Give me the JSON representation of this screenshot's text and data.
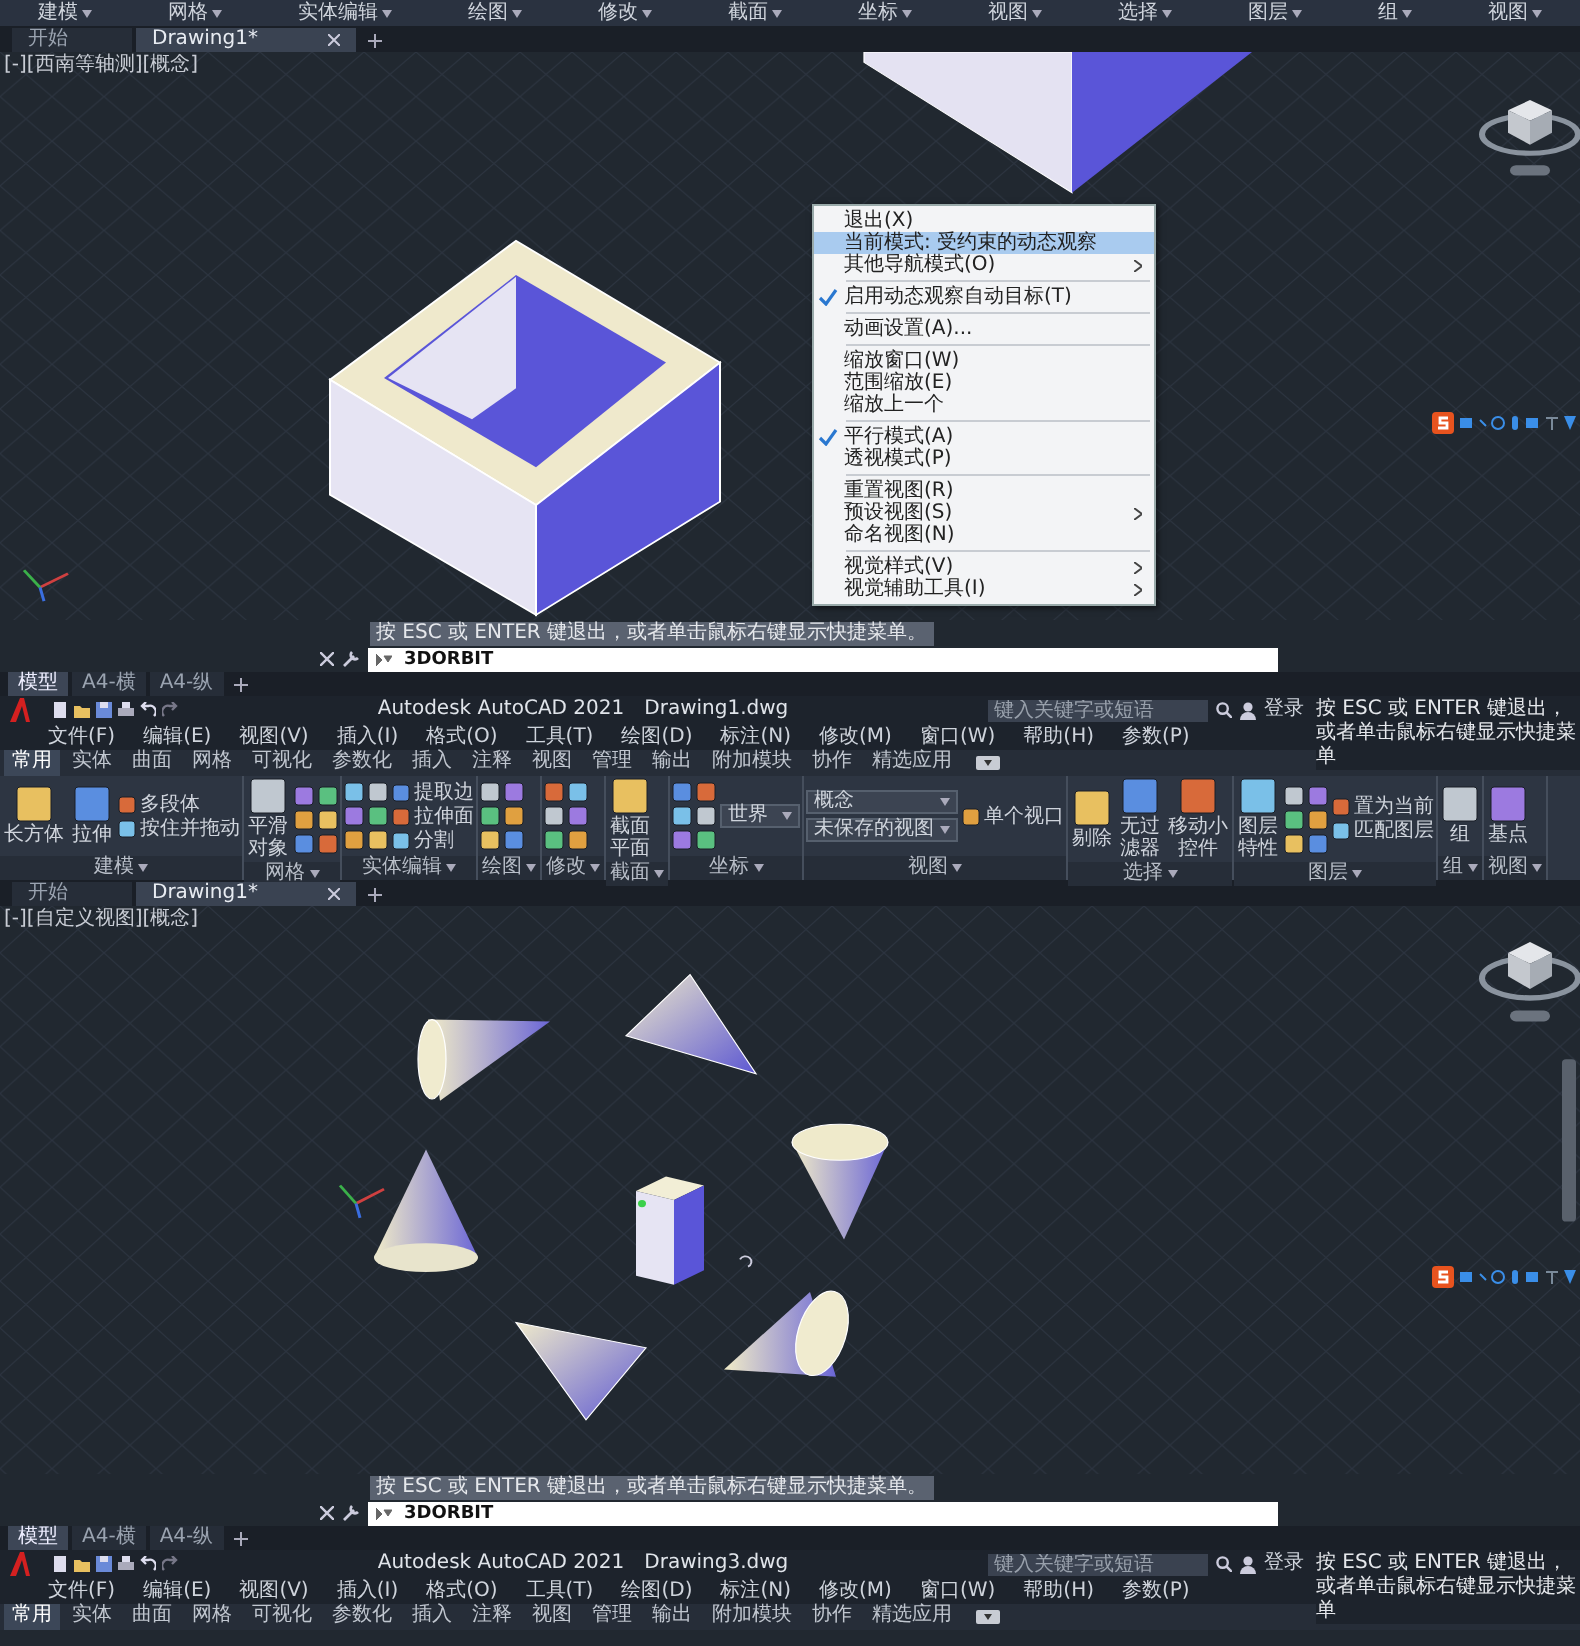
{
  "top_capture": {
    "ribbon_panel_labels": [
      "建模",
      "网格",
      "实体编辑",
      "绘图",
      "修改",
      "截面",
      "坐标",
      "视图",
      "选择",
      "图层",
      "组",
      "视图"
    ],
    "doc_tabs": [
      {
        "label": "开始",
        "selected": false
      },
      {
        "label": "Drawing1*",
        "selected": true
      }
    ],
    "viewport_label": "[-][西南等轴测][概念]",
    "context_menu": {
      "groups": [
        [
          {
            "label": "退出(X)",
            "checked": false,
            "selected": false,
            "submenu": false
          },
          {
            "label": "当前模式: 受约束的动态观察",
            "checked": false,
            "selected": true,
            "submenu": false
          },
          {
            "label": "其他导航模式(O)",
            "checked": false,
            "selected": false,
            "submenu": true
          }
        ],
        [
          {
            "label": "启用动态观察自动目标(T)",
            "checked": true,
            "selected": false,
            "submenu": false
          }
        ],
        [
          {
            "label": "动画设置(A)...",
            "checked": false,
            "selected": false,
            "submenu": false
          }
        ],
        [
          {
            "label": "缩放窗口(W)",
            "checked": false,
            "selected": false,
            "submenu": false
          },
          {
            "label": "范围缩放(E)",
            "checked": false,
            "selected": false,
            "submenu": false
          },
          {
            "label": "缩放上一个",
            "checked": false,
            "selected": false,
            "submenu": false
          }
        ],
        [
          {
            "label": "平行模式(A)",
            "checked": true,
            "selected": false,
            "submenu": false
          },
          {
            "label": "透视模式(P)",
            "checked": false,
            "selected": false,
            "submenu": false
          }
        ],
        [
          {
            "label": "重置视图(R)",
            "checked": false,
            "selected": false,
            "submenu": false
          },
          {
            "label": "预设视图(S)",
            "checked": false,
            "selected": false,
            "submenu": true
          },
          {
            "label": "命名视图(N)",
            "checked": false,
            "selected": false,
            "submenu": false
          }
        ],
        [
          {
            "label": "视觉样式(V)",
            "checked": false,
            "selected": false,
            "submenu": true
          },
          {
            "label": "视觉辅助工具(I)",
            "checked": false,
            "selected": false,
            "submenu": true
          }
        ]
      ]
    },
    "command_prompt": "按 ESC 或 ENTER 键退出，或者单击鼠标右键显示快捷菜单。",
    "command_input": "3DORBIT"
  },
  "middle_window": {
    "layout_tabs": [
      {
        "label": "模型",
        "selected": true
      },
      {
        "label": "A4-横",
        "selected": false
      },
      {
        "label": "A4-纵",
        "selected": false
      }
    ],
    "app_title": "Autodesk AutoCAD 2021",
    "file_name": "Drawing1.dwg",
    "search_placeholder": "键入关键字或短语",
    "sign_in": "登录",
    "status_hint": "按 ESC 或 ENTER 键退出，或者单击鼠标右键显示快捷菜单",
    "menu_bar": [
      "文件(F)",
      "编辑(E)",
      "视图(V)",
      "插入(I)",
      "格式(O)",
      "工具(T)",
      "绘图(D)",
      "标注(N)",
      "修改(M)",
      "窗口(W)",
      "帮助(H)",
      "参数(P)"
    ],
    "ribbon_tabs": [
      {
        "label": "常用",
        "selected": true
      },
      {
        "label": "实体",
        "selected": false
      },
      {
        "label": "曲面",
        "selected": false
      },
      {
        "label": "网格",
        "selected": false
      },
      {
        "label": "可视化",
        "selected": false
      },
      {
        "label": "参数化",
        "selected": false
      },
      {
        "label": "插入",
        "selected": false
      },
      {
        "label": "注释",
        "selected": false
      },
      {
        "label": "视图",
        "selected": false
      },
      {
        "label": "管理",
        "selected": false
      },
      {
        "label": "输出",
        "selected": false
      },
      {
        "label": "附加模块",
        "selected": false
      },
      {
        "label": "协作",
        "selected": false
      },
      {
        "label": "精选应用",
        "selected": false
      }
    ],
    "ribbon_panels": [
      {
        "label": "建模",
        "items": [
          {
            "kind": "large",
            "label": "长方体"
          },
          {
            "kind": "large",
            "label": "拉伸"
          },
          {
            "kind": "small",
            "label": "多段体"
          },
          {
            "kind": "small",
            "label": "按住并拖动"
          }
        ]
      },
      {
        "label": "网格",
        "items": [
          {
            "kind": "large",
            "label": "平滑对象"
          },
          {
            "kind": "icon-grid"
          }
        ]
      },
      {
        "label": "实体编辑",
        "items": [
          {
            "kind": "icon-grid"
          },
          {
            "kind": "small",
            "label": "提取边"
          },
          {
            "kind": "small",
            "label": "拉伸面"
          },
          {
            "kind": "small",
            "label": "分割"
          }
        ]
      },
      {
        "label": "绘图",
        "items": [
          {
            "kind": "icon-grid"
          }
        ]
      },
      {
        "label": "修改",
        "items": [
          {
            "kind": "icon-grid"
          }
        ]
      },
      {
        "label": "截面",
        "items": [
          {
            "kind": "large",
            "label": "截面平面"
          }
        ]
      },
      {
        "label": "坐标",
        "items": [
          {
            "kind": "icon-grid"
          },
          {
            "kind": "dropdown",
            "label": "世界"
          }
        ]
      },
      {
        "label": "视图",
        "items": [
          {
            "kind": "dropdown",
            "label": "概念"
          },
          {
            "kind": "dropdown",
            "label": "未保存的视图"
          },
          {
            "kind": "small",
            "label": "单个视口"
          }
        ]
      },
      {
        "label": "选择",
        "items": [
          {
            "kind": "large",
            "label": "剔除"
          },
          {
            "kind": "large",
            "label": "无过滤器"
          },
          {
            "kind": "large",
            "label": "移动小控件"
          }
        ]
      },
      {
        "label": "图层",
        "items": [
          {
            "kind": "large",
            "label": "图层特性"
          },
          {
            "kind": "icon-grid"
          },
          {
            "kind": "small",
            "label": "置为当前"
          },
          {
            "kind": "small",
            "label": "匹配图层"
          }
        ]
      },
      {
        "label": "组",
        "items": [
          {
            "kind": "large",
            "label": "组"
          }
        ]
      },
      {
        "label": "视图",
        "items": [
          {
            "kind": "large",
            "label": "基点"
          }
        ]
      }
    ],
    "doc_tabs": [
      {
        "label": "开始",
        "selected": false
      },
      {
        "label": "Drawing1*",
        "selected": true
      }
    ],
    "viewport_label": "[-][自定义视图][概念]",
    "command_prompt": "按 ESC 或 ENTER 键退出，或者单击鼠标右键显示快捷菜单。",
    "command_input": "3DORBIT"
  },
  "bottom_window": {
    "layout_tabs": [
      {
        "label": "模型",
        "selected": true
      },
      {
        "label": "A4-横",
        "selected": false
      },
      {
        "label": "A4-纵",
        "selected": false
      }
    ],
    "app_title": "Autodesk AutoCAD 2021",
    "file_name": "Drawing3.dwg",
    "search_placeholder": "键入关键字或短语",
    "sign_in": "登录",
    "status_hint": "按 ESC 或 ENTER 键退出，或者单击鼠标右键显示快捷菜单",
    "menu_bar": [
      "文件(F)",
      "编辑(E)",
      "视图(V)",
      "插入(I)",
      "格式(O)",
      "工具(T)",
      "绘图(D)",
      "标注(N)",
      "修改(M)",
      "窗口(W)",
      "帮助(H)",
      "参数(P)"
    ],
    "ribbon_tabs": [
      {
        "label": "常用",
        "selected": true
      },
      {
        "label": "实体",
        "selected": false
      },
      {
        "label": "曲面",
        "selected": false
      },
      {
        "label": "网格",
        "selected": false
      },
      {
        "label": "可视化",
        "selected": false
      },
      {
        "label": "参数化",
        "selected": false
      },
      {
        "label": "插入",
        "selected": false
      },
      {
        "label": "注释",
        "selected": false
      },
      {
        "label": "视图",
        "selected": false
      },
      {
        "label": "管理",
        "selected": false
      },
      {
        "label": "输出",
        "selected": false
      },
      {
        "label": "附加模块",
        "selected": false
      },
      {
        "label": "协作",
        "selected": false
      },
      {
        "label": "精选应用",
        "selected": false
      }
    ]
  }
}
